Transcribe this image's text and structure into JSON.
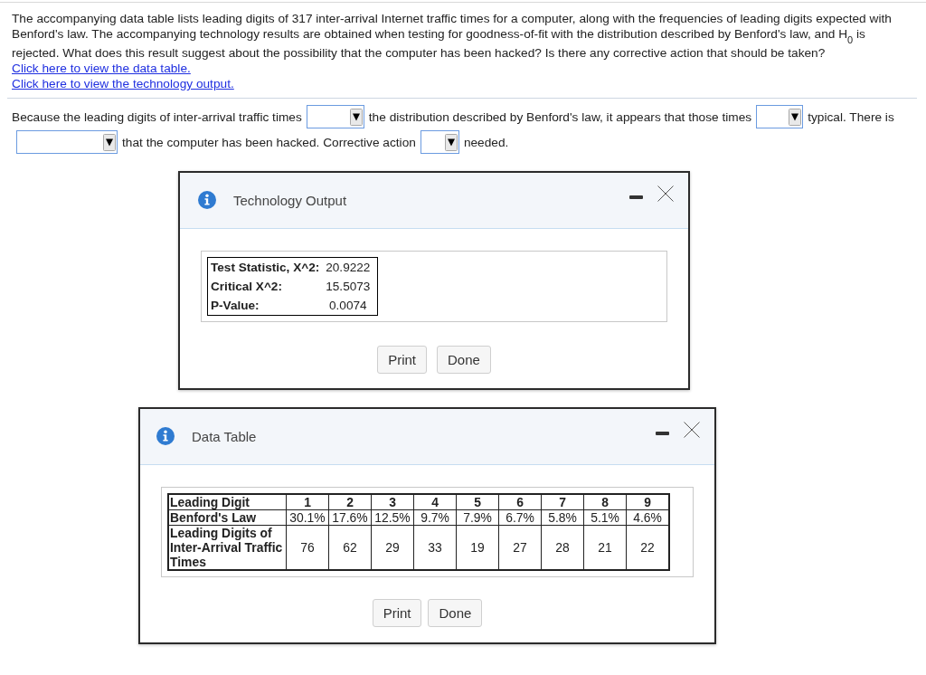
{
  "question": {
    "text": "The accompanying data table lists leading digits of 317 inter-arrival Internet traffic times for a computer, along with the frequencies of leading digits expected with Benford's law. The accompanying technology results are obtained when testing for goodness-of-fit with the distribution described by Benford's law, and H$_{0}$ is rejected. What does this result suggest about the possibility that the computer has been hacked? Is there any corrective action that should be taken?",
    "links": [
      "Click here to view the data table.",
      "Click here to view the technology output."
    ]
  },
  "answer": {
    "parts": [
      {
        "kind": "text",
        "text": "Because the leading digits of inter-arrival traffic times"
      },
      {
        "kind": "dropdown"
      },
      {
        "kind": "text",
        "text": "the distribution described by Benford's law, it appears that those times"
      },
      {
        "kind": "dropdown"
      },
      {
        "kind": "text",
        "text": "typical. There is"
      },
      {
        "kind": "dropdown"
      },
      {
        "kind": "text",
        "text": "that the computer has been hacked. Corrective action"
      },
      {
        "kind": "dropdown"
      },
      {
        "kind": "text",
        "text": "needed."
      }
    ]
  },
  "technology_output": {
    "title": "Technology Output",
    "rows": [
      {
        "label": "Test Statistic, X^2:",
        "value": "20.9222"
      },
      {
        "label": "Critical X^2:",
        "value": "15.5073"
      },
      {
        "label": "P-Value:",
        "value": "0.0074"
      }
    ],
    "buttons": [
      "Print",
      "Done"
    ]
  },
  "data_table": {
    "title": "Data Table",
    "columns": [
      "Leading Digit",
      "1",
      "2",
      "3",
      "4",
      "5",
      "6",
      "7",
      "8",
      "9"
    ],
    "rows": [
      {
        "cells": [
          "Benford's Law",
          "30.1%",
          "17.6%",
          "12.5%",
          "9.7%",
          "7.9%",
          "6.7%",
          "5.8%",
          "5.1%",
          "4.6%"
        ]
      },
      {
        "cells": [
          "Leading Digits of Inter-Arrival Traffic Times",
          "76",
          "62",
          "29",
          "33",
          "19",
          "27",
          "28",
          "21",
          "22"
        ]
      }
    ],
    "buttons": [
      "Print",
      "Done"
    ]
  }
}
